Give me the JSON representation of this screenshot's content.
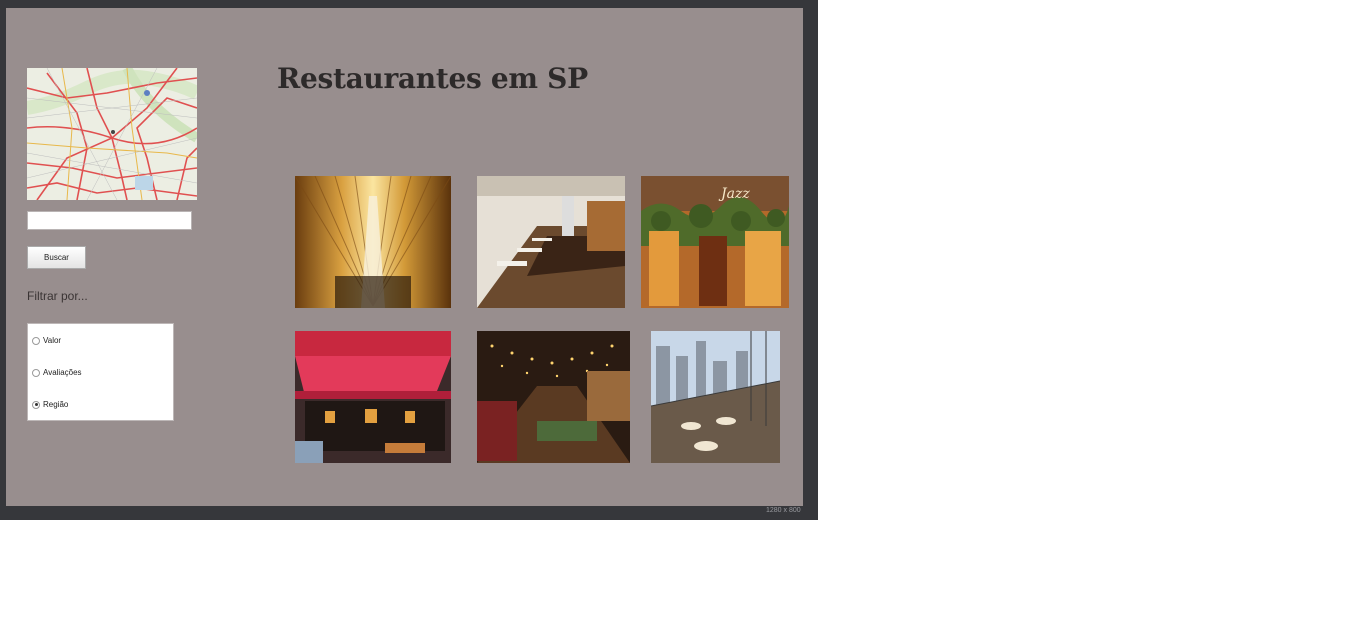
{
  "page": {
    "title": "Restaurantes em SP",
    "size_label": "1280 x 800"
  },
  "sidebar": {
    "map_label": "mapa de São Paulo",
    "search": {
      "value": "",
      "placeholder": ""
    },
    "search_button": "Buscar",
    "filter_label": "Filtrar por...",
    "filter_options": [
      {
        "label": "Valor",
        "checked": false
      },
      {
        "label": "Avaliações",
        "checked": false
      },
      {
        "label": "Região",
        "checked": true
      }
    ]
  },
  "gallery": [
    {
      "name": "restaurant-photo-1",
      "alt": "interior com teto de madeira"
    },
    {
      "name": "restaurant-photo-2",
      "alt": "salão branco com mesas"
    },
    {
      "name": "restaurant-photo-3",
      "alt": "fachada com plantas"
    },
    {
      "name": "restaurant-photo-4",
      "alt": "fachada com toldo vermelho"
    },
    {
      "name": "restaurant-photo-5",
      "alt": "salão com luzes penduradas"
    },
    {
      "name": "restaurant-photo-6",
      "alt": "terraço com vista da cidade"
    }
  ],
  "colors": {
    "frame": "#36373b",
    "canvas": "#988e8e",
    "title": "#2d2a2a"
  }
}
